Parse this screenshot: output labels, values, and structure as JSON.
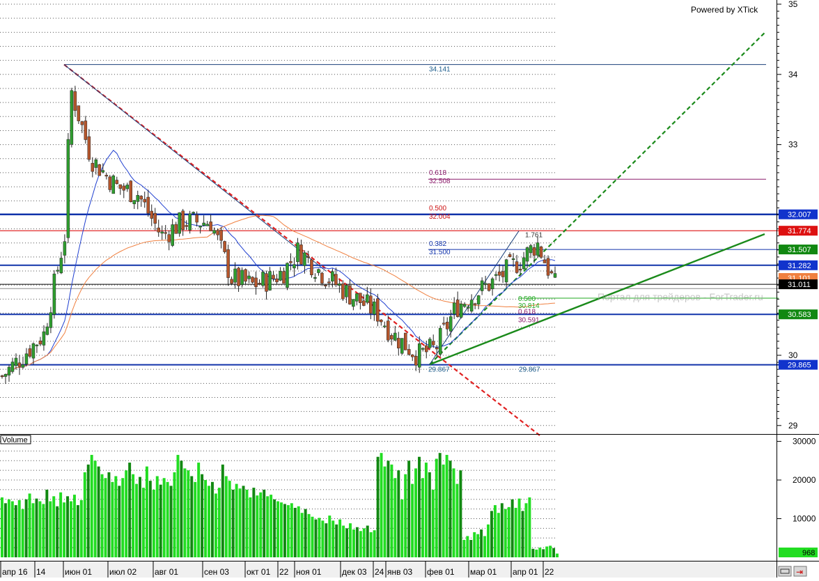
{
  "header": {
    "powered_by": "Powered by XTick"
  },
  "watermark": "Портал для трейдеров - ForTrader.ru",
  "colors": {
    "up": "#2f9e2f",
    "down": "#b5562c",
    "ma_fast": "#1f3fd0",
    "ma_slow": "#f08040",
    "resistance": "#1133aa",
    "red_line": "#e02020",
    "trend_green": "#1a8a1a",
    "volume_bright": "#22dd22",
    "volume_dark": "#118811"
  },
  "x_axis": {
    "labels": [
      "апр 16",
      "14",
      "июн 01",
      "июл 02",
      "авг 01",
      "сен 03",
      "окт 01",
      "22",
      "ноя 01",
      "дек 03",
      "24",
      "янв 03",
      "фев 01",
      "мар 01",
      "апр 01",
      "22"
    ]
  },
  "price_axis": {
    "ticks": [
      "35",
      "34",
      "33",
      "30",
      "29"
    ]
  },
  "volume_panel": {
    "label": "Volume",
    "ticks": [
      "30000",
      "20000",
      "10000"
    ],
    "last_value": "968"
  },
  "price_badges": [
    {
      "value": "32.007",
      "bg": "#1133cc",
      "fg": "#ffffff",
      "price": 32.007
    },
    {
      "value": "31.774",
      "bg": "#dd1111",
      "fg": "#ffffff",
      "price": 31.774
    },
    {
      "value": "31.507",
      "bg": "#118811",
      "fg": "#ffffff",
      "price": 31.507
    },
    {
      "value": "31.282",
      "bg": "#1133cc",
      "fg": "#ffffff",
      "price": 31.282
    },
    {
      "value": "31.101",
      "bg": "#f08040",
      "fg": "#ffffff",
      "price": 31.101
    },
    {
      "value": "31.011",
      "bg": "#000000",
      "fg": "#ffffff",
      "price": 31.011
    },
    {
      "value": "30.583",
      "bg": "#118811",
      "fg": "#ffffff",
      "price": 30.583
    },
    {
      "value": "29.865",
      "bg": "#1133cc",
      "fg": "#ffffff",
      "price": 29.865
    }
  ],
  "fib_labels": [
    {
      "text": "34.141",
      "color": "#1a5a8a",
      "price": 34.141
    },
    {
      "text": "0.618",
      "color": "#8a1a6a",
      "price": 32.508
    },
    {
      "text": "32.508",
      "color": "#8a1a6a",
      "price": 32.508
    },
    {
      "text": "0.500",
      "color": "#cc1111",
      "price": 32.004
    },
    {
      "text": "32.004",
      "color": "#cc1111",
      "price": 32.004
    },
    {
      "text": "0.382",
      "color": "#1133aa",
      "price": 31.5
    },
    {
      "text": "31.500",
      "color": "#1133aa",
      "price": 31.5
    },
    {
      "text": "1.761",
      "color": "#333333",
      "price": 31.761
    },
    {
      "text": "0.500",
      "color": "#22aa22",
      "price": 30.814
    },
    {
      "text": "30.814",
      "color": "#22aa22",
      "price": 30.814
    },
    {
      "text": "0.618",
      "color": "#8a1a6a",
      "price": 30.591
    },
    {
      "text": "30.591",
      "color": "#8a1a6a",
      "price": 30.591
    },
    {
      "text": "29.867",
      "color": "#1a5a8a",
      "price": 29.867
    },
    {
      "text": "29.867",
      "color": "#1a5a8a",
      "price": 29.867
    }
  ],
  "chart_data": {
    "type": "line",
    "title": "",
    "x_range": [
      "2018-04-16",
      "2019-04-22"
    ],
    "ylim": [
      28.8,
      35.05
    ],
    "grid": true,
    "close_series_approx": {
      "name": "",
      "x": [
        "2018-04-16",
        "2018-05-14",
        "2018-05-28",
        "2018-06-01",
        "2018-06-15",
        "2018-07-02",
        "2018-07-16",
        "2018-08-01",
        "2018-08-15",
        "2018-09-03",
        "2018-09-17",
        "2018-10-01",
        "2018-10-15",
        "2018-10-22",
        "2018-11-01",
        "2018-11-15",
        "2018-12-03",
        "2018-12-24",
        "2019-01-03",
        "2019-01-20",
        "2019-02-01",
        "2019-02-15",
        "2019-03-01",
        "2019-03-15",
        "2019-04-01",
        "2019-04-10",
        "2019-04-22"
      ],
      "values": [
        29.7,
        30.3,
        31.7,
        33.8,
        32.8,
        32.4,
        32.3,
        31.7,
        31.9,
        31.9,
        31.1,
        31.0,
        31.1,
        31.2,
        31.5,
        31.2,
        30.9,
        30.6,
        30.3,
        30.0,
        30.1,
        30.7,
        30.9,
        31.1,
        31.4,
        31.6,
        31.0
      ]
    },
    "horizontal_levels": [
      34.141,
      32.508,
      32.007,
      31.774,
      31.507,
      31.282,
      31.101,
      31.011,
      30.814,
      30.583,
      29.865
    ],
    "volume": {
      "ylim": [
        0,
        31000
      ],
      "values": [
        15500,
        14000,
        15000,
        14500,
        13500,
        14800,
        12500,
        15000,
        16500,
        14000,
        15200,
        14500,
        13800,
        17500,
        14500,
        15800,
        13200,
        16800,
        14200,
        15800,
        14500,
        16200,
        13500,
        14800,
        22000,
        24000,
        26500,
        25000,
        23500,
        21500,
        20500,
        22000,
        19500,
        21000,
        18500,
        20500,
        22500,
        24500,
        21500,
        19000,
        20800,
        18000,
        23500,
        19800,
        17500,
        21000,
        18800,
        20500,
        19500,
        18500,
        22000,
        26500,
        25000,
        23000,
        22500,
        21000,
        19500,
        24500,
        21500,
        20000,
        18500,
        19500,
        16500,
        18000,
        24000,
        21000,
        19800,
        17500,
        19000,
        17800,
        18500,
        17500,
        15500,
        18000,
        16000,
        16800,
        17500,
        15800,
        16200,
        15000,
        14500,
        14200,
        13800,
        13500,
        14000,
        12800,
        13200,
        11500,
        12500,
        11200,
        10500,
        9800,
        10200,
        9500,
        8800,
        10800,
        9500,
        8500,
        9800,
        8200,
        7500,
        8800,
        7200,
        7800,
        6800,
        7500,
        8200,
        6500,
        7000,
        26000,
        27000,
        23500,
        25000,
        24000,
        20500,
        22500,
        15000,
        21500,
        25000,
        19000,
        23000,
        26000,
        20500,
        24500,
        22000,
        17500,
        25500,
        27000,
        24000,
        26500,
        25000,
        23000,
        19000,
        22500,
        4500,
        5500,
        4500,
        6500,
        6000,
        7200,
        5500,
        8500,
        12000,
        13500,
        11500,
        14000,
        12500,
        13000,
        15000,
        12800,
        15200,
        12000,
        14000,
        15500,
        2200,
        2000,
        2500,
        2100,
        2800,
        3000,
        2400,
        968
      ]
    }
  }
}
